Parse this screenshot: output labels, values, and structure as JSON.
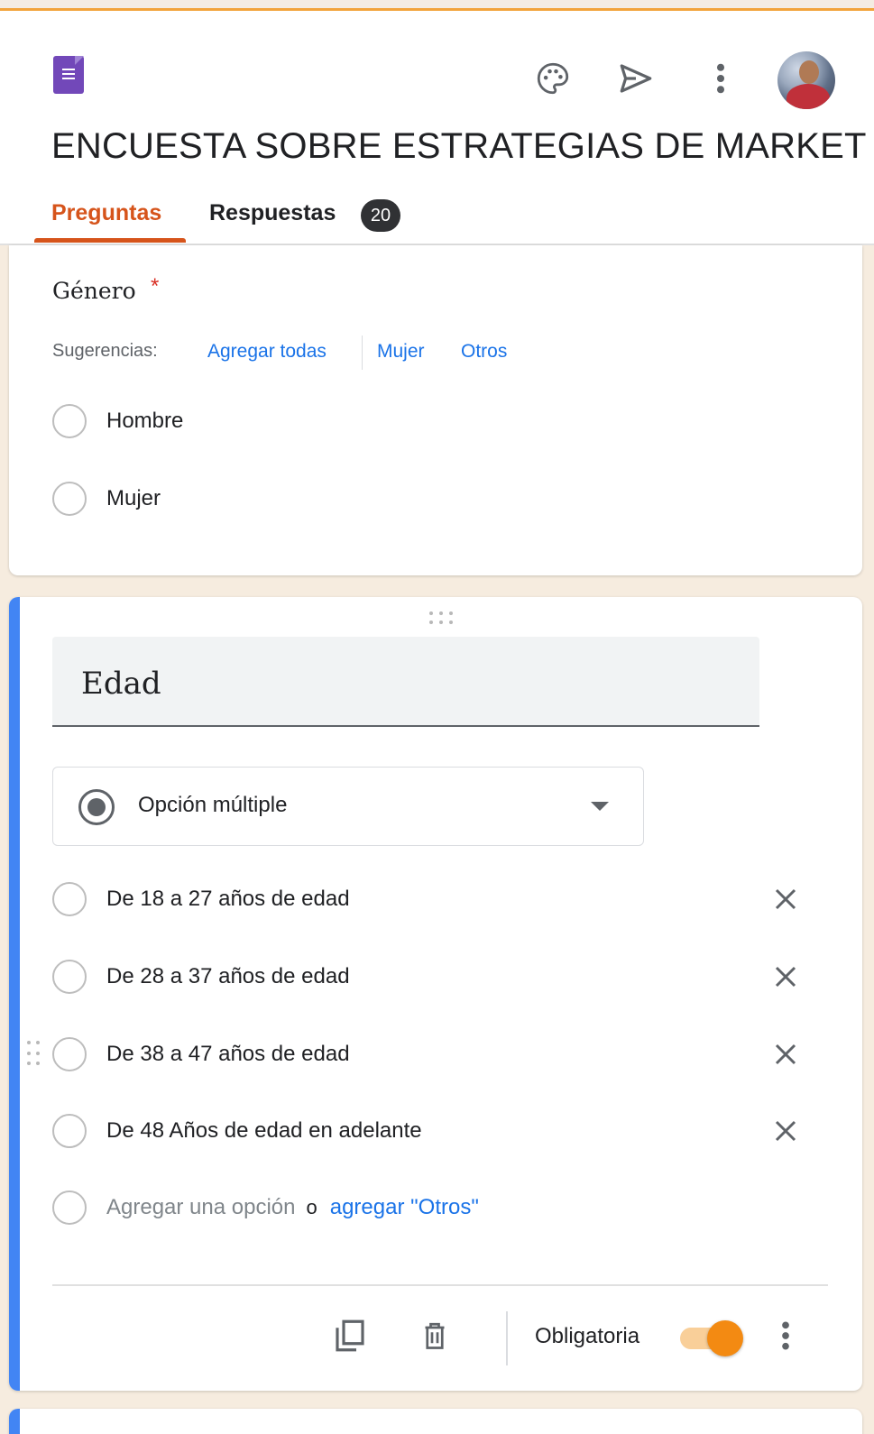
{
  "app": {
    "accent_color": "#d6541b",
    "logo_icon": "google-forms-logo-icon",
    "header_icons": [
      "palette-icon",
      "send-icon",
      "more-vert-icon"
    ],
    "avatar_icon": "user-avatar"
  },
  "form": {
    "title": "ENCUESTA SOBRE ESTRATEGIAS DE MARKET"
  },
  "tabs": [
    {
      "label": "Preguntas",
      "active": true
    },
    {
      "label": "Respuestas",
      "active": false,
      "badge": "20"
    }
  ],
  "questions": [
    {
      "title": "Género",
      "required_marker": "*",
      "suggestions": {
        "label": "Sugerencias:",
        "items": [
          "Agregar todas",
          "Mujer",
          "Otros"
        ]
      },
      "options": [
        "Hombre",
        "Mujer"
      ]
    },
    {
      "title": "Edad",
      "type_label": "Opción múltiple",
      "options": [
        "De 18 a 27 años de edad",
        "De 28 a 37 años de edad",
        "De 38 a 47 años de edad",
        "De 48 Años de edad en adelante"
      ],
      "add_option": {
        "text": "Agregar una opción",
        "or": "o",
        "other_link": "agregar \"Otros\""
      },
      "footer": {
        "icons": [
          "duplicate-icon",
          "delete-icon"
        ],
        "required_label": "Obligatoria",
        "required_on": true
      }
    }
  ],
  "colors": {
    "link": "#1a73e8",
    "active_card_border": "#4285f4",
    "toggle_on": "#f38a12",
    "page_background": "#f6ecdf"
  }
}
